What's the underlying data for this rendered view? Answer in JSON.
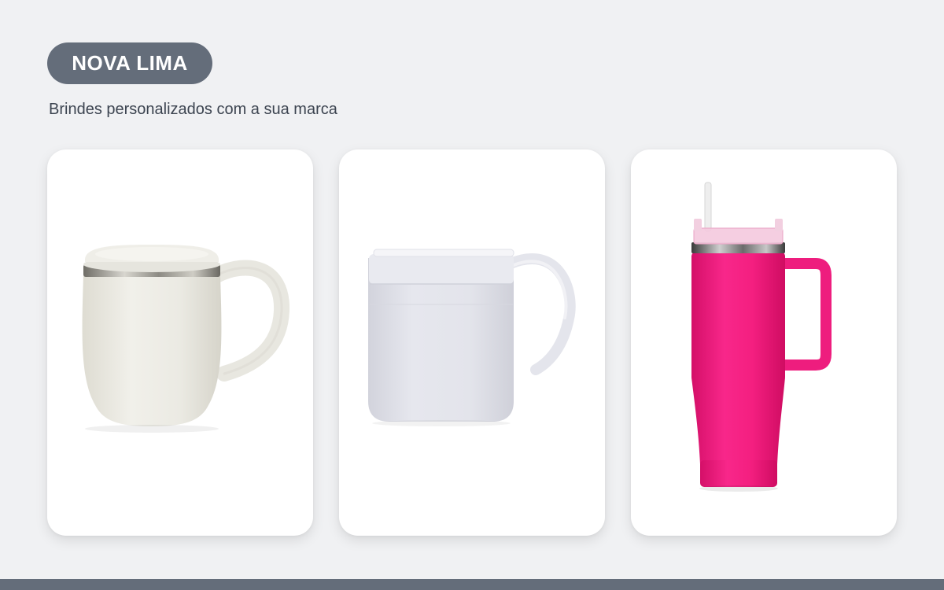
{
  "brand": {
    "name": "NOVA LIMA"
  },
  "tagline": "Brindes personalizados com a sua marca",
  "products": [
    {
      "icon": "ceramic-mug-with-lid-icon",
      "color": "#ecebe4"
    },
    {
      "icon": "thermal-mug-icon",
      "color": "#e3e4ec"
    },
    {
      "icon": "tumbler-with-straw-icon",
      "color": "#f21c7c"
    }
  ],
  "colors": {
    "background": "#f0f1f3",
    "accent": "#646d7a",
    "text": "#3c4450",
    "card": "#ffffff"
  }
}
